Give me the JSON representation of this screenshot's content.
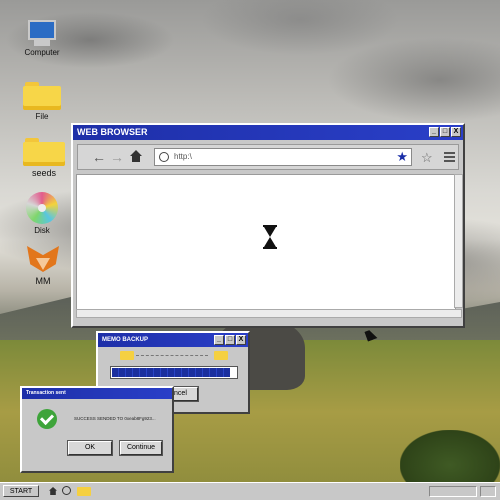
{
  "desktop": {
    "icons": [
      {
        "label": "Computer",
        "icon": "computer-icon"
      },
      {
        "label": "File",
        "icon": "folder-icon"
      },
      {
        "label": "seeds",
        "icon": "folder-icon"
      },
      {
        "label": "Disk",
        "icon": "disk-icon"
      },
      {
        "label": "MM",
        "icon": "fox-icon"
      }
    ]
  },
  "browser": {
    "title": "WEB BROWSER",
    "address": "http:\\",
    "buttons": {
      "minimize": "_",
      "maximize": "□",
      "close": "X"
    },
    "accent": "#1b2ea8"
  },
  "memo": {
    "title": "MEMO BACKUP",
    "progress": 0.95,
    "cancel_label": "Cancel"
  },
  "transaction": {
    "title": "Transaction sent",
    "message": "SUCCESS SENDED TO 0xeab8Fg923...",
    "ok_label": "OK",
    "continue_label": "Continue"
  },
  "taskbar": {
    "start_label": "START"
  }
}
